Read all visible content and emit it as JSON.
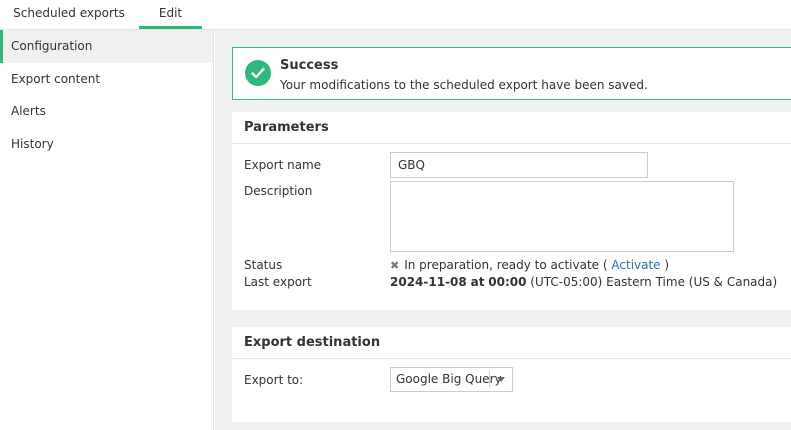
{
  "tabs": [
    {
      "label": "Scheduled exports"
    },
    {
      "label": "Edit"
    }
  ],
  "sidebar": {
    "items": [
      {
        "label": "Configuration"
      },
      {
        "label": "Export content"
      },
      {
        "label": "Alerts"
      },
      {
        "label": "History"
      }
    ]
  },
  "alert": {
    "title": "Success",
    "message": "Your modifications to the scheduled export have been saved."
  },
  "parameters": {
    "title": "Parameters",
    "export_name_label": "Export name",
    "export_name_value": "GBQ",
    "description_label": "Description",
    "description_value": "",
    "status_label": "Status",
    "status_text": "In preparation, ready to activate (",
    "status_link": "Activate",
    "status_close": ")",
    "last_export_label": "Last export",
    "last_export_date": "2024-11-08",
    "last_export_at": "at",
    "last_export_time": "00:00",
    "last_export_tz": "(UTC-05:00) Eastern Time (US & Canada)"
  },
  "destination": {
    "title": "Export destination",
    "export_to_label": "Export to:",
    "export_to_value": "Google Big Query"
  },
  "colors": {
    "accent": "#2fb879",
    "link": "#2a6ebb"
  },
  "icons": {
    "success": "check-circle-icon",
    "status": "x-icon",
    "dropdown": "chevron-down-icon"
  }
}
